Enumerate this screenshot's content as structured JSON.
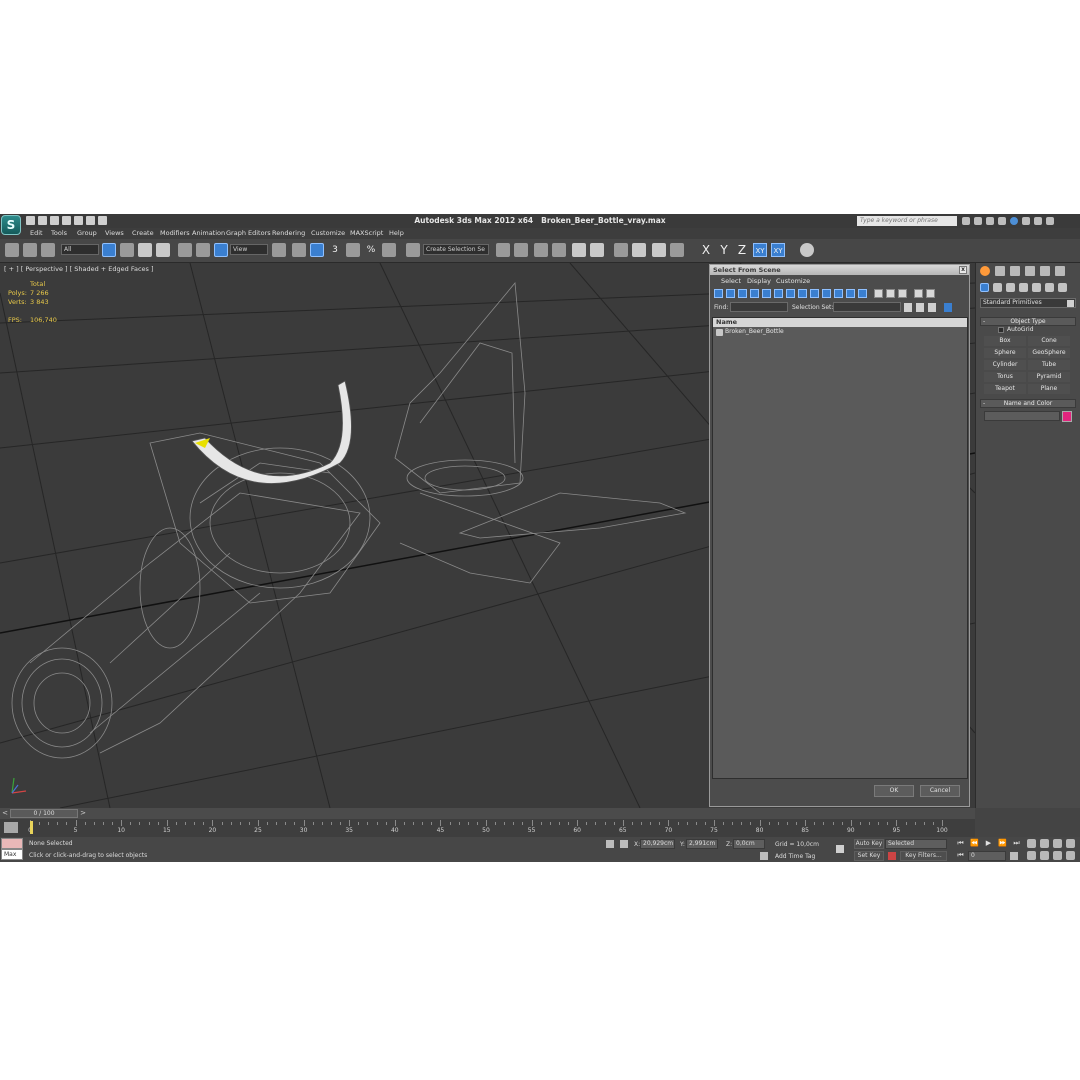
{
  "window": {
    "app_title": "Autodesk 3ds Max  2012 x64",
    "file_name": "Broken_Beer_Bottle_vray.max",
    "search_placeholder": "Type a keyword or phrase"
  },
  "menu": [
    "Edit",
    "Tools",
    "Group",
    "Views",
    "Create",
    "Modifiers",
    "Animation",
    "Graph Editors",
    "Rendering",
    "Customize",
    "MAXScript",
    "Help"
  ],
  "toolbar": {
    "selection_filter": "All",
    "ref_coord": "View",
    "snap_labels": [
      "3",
      "%"
    ],
    "named_selection": "Create Selection Se",
    "axes": [
      "X",
      "Y",
      "Z",
      "XY",
      "XY"
    ]
  },
  "viewport": {
    "label": "[ + ] [ Perspective ] [ Shaded + Edged Faces ]",
    "stats": {
      "total_label": "Total",
      "polys_label": "Polys:",
      "polys_value": "7 266",
      "verts_label": "Verts:",
      "verts_value": "3 843",
      "fps_label": "FPS:",
      "fps_value": "106,740"
    }
  },
  "dialog": {
    "title": "Select From Scene",
    "menus": [
      "Select",
      "Display",
      "Customize"
    ],
    "find_label": "Find:",
    "selection_set_label": "Selection Set:",
    "column_name": "Name",
    "items": [
      "Broken_Beer_Bottle"
    ],
    "ok_label": "OK",
    "cancel_label": "Cancel"
  },
  "command_panel": {
    "category": "Standard Primitives",
    "object_type_title": "Object Type",
    "autogrid_label": "AutoGrid",
    "primitives": [
      "Box",
      "Cone",
      "Sphere",
      "GeoSphere",
      "Cylinder",
      "Tube",
      "Torus",
      "Pyramid",
      "Teapot",
      "Plane"
    ],
    "name_color_title": "Name and Color",
    "object_color": "#e2257e"
  },
  "timeline": {
    "frame_display": "0 / 100",
    "tick_labels": [
      "0",
      "5",
      "10",
      "15",
      "20",
      "25",
      "30",
      "35",
      "40",
      "45",
      "50",
      "55",
      "60",
      "65",
      "70",
      "75",
      "80",
      "85",
      "90",
      "95",
      "100"
    ]
  },
  "status": {
    "maxscript_label": "Max",
    "selection_status": "None Selected",
    "prompt": "Click or click-and-drag to select objects",
    "x_label": "X:",
    "x_value": "20,929cm",
    "y_label": "Y:",
    "y_value": "2,991cm",
    "z_label": "Z:",
    "z_value": "0,0cm",
    "grid": "Grid = 10,0cm",
    "add_time_tag": "Add Time Tag",
    "auto_key": "Auto Key",
    "set_key": "Set Key",
    "key_mode": "Selected",
    "key_filters": "Key Filters...",
    "current_frame": "0"
  }
}
